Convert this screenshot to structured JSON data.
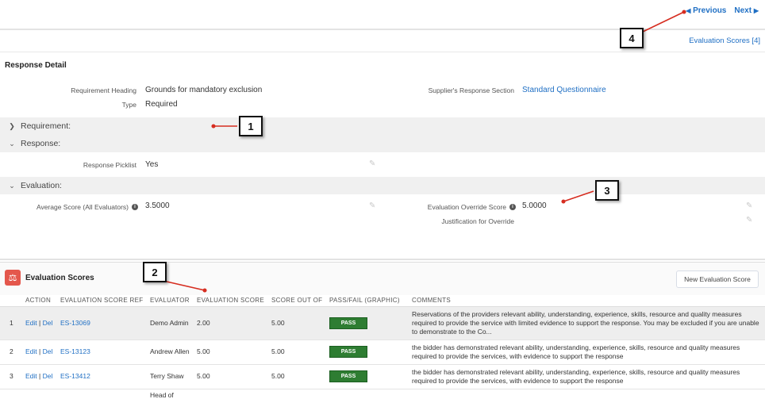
{
  "nav": {
    "previous": "Previous",
    "next": "Next",
    "evaluation_scores_link": "Evaluation Scores [4]"
  },
  "detail": {
    "title": "Response Detail",
    "fields": {
      "requirement_heading_label": "Requirement Heading",
      "requirement_heading_value": "Grounds for mandatory exclusion",
      "type_label": "Type",
      "type_value": "Required",
      "suppliers_section_label": "Supplier's Response Section",
      "suppliers_section_value": "Standard Questionnaire"
    },
    "sections": {
      "requirement": "Requirement:",
      "response": "Response:",
      "evaluation": "Evaluation:"
    },
    "response_picklist_label": "Response Picklist",
    "response_picklist_value": "Yes",
    "average_score_label": "Average Score (All Evaluators)",
    "average_score_value": "3.5000",
    "override_score_label": "Evaluation Override Score",
    "override_score_value": "5.0000",
    "justification_label": "Justification for Override"
  },
  "callouts": [
    "1",
    "2",
    "3",
    "4"
  ],
  "related_list": {
    "title": "Evaluation Scores",
    "icon": "scales-icon",
    "new_button": "New Evaluation Score",
    "columns": [
      "ACTION",
      "EVALUATION SCORE REF",
      "EVALUATOR",
      "EVALUATION SCORE",
      "SCORE OUT OF",
      "PASS/FAIL (GRAPHIC)",
      "COMMENTS"
    ],
    "rows": [
      {
        "num": "1",
        "edit": "Edit",
        "del": "Del",
        "ref": "ES-13069",
        "evaluator": "Demo Admin",
        "score": "2.00",
        "out_of": "5.00",
        "pass": "PASS",
        "comments": "Reservations of the providers relevant ability, understanding, experience, skills, resource and quality measures required to provide the service with limited evidence to support the response. You may be excluded if you are unable to demonstrate to the Co..."
      },
      {
        "num": "2",
        "edit": "Edit",
        "del": "Del",
        "ref": "ES-13123",
        "evaluator": "Andrew Allen",
        "score": "5.00",
        "out_of": "5.00",
        "pass": "PASS",
        "comments": "the bidder has demonstrated relevant ability, understanding, experience, skills, resource and quality measures required to provide the services, with evidence to support the response"
      },
      {
        "num": "3",
        "edit": "Edit",
        "del": "Del",
        "ref": "ES-13412",
        "evaluator": "Terry Shaw",
        "score": "5.00",
        "out_of": "5.00",
        "pass": "PASS",
        "comments": "the bidder has demonstrated relevant ability, understanding, experience, skills, resource and quality measures required to provide the services, with evidence to support the response"
      },
      {
        "num": "",
        "edit": "",
        "del": "",
        "ref": "",
        "evaluator": "Head of",
        "score": "",
        "out_of": "",
        "pass": "",
        "comments": ""
      }
    ]
  },
  "colors": {
    "link": "#1f6fc4",
    "pass_green": "#2e7d32",
    "list_icon": "#e4574c",
    "band": "#f0f0f0"
  }
}
